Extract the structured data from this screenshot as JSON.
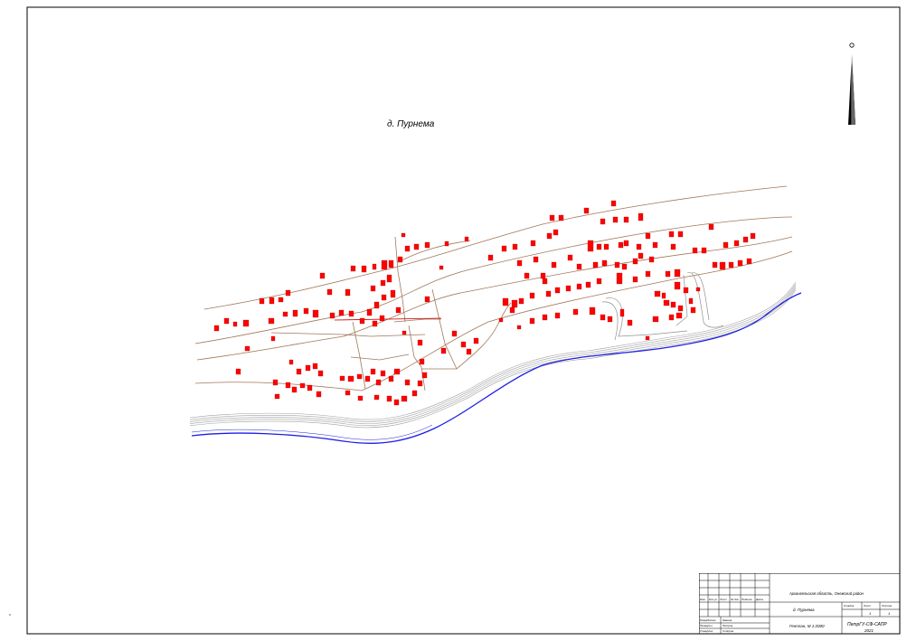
{
  "map": {
    "settlement_label": "д. Пурнема",
    "building_color": "#ff0000",
    "contour_color": "#a0785a",
    "road_color": "#a0a0a0",
    "river_color": "#1e1ee6",
    "north_arrow": "north-arrow-icon"
  },
  "title_block": {
    "region": "Архангельская область, Онежский район",
    "object": "д. Пурнема",
    "sheet_name": "Генплан, М 1:2000",
    "stage_label": "Стадия",
    "sheet_label": "Лист",
    "sheets_label": "Листов",
    "stage": "",
    "sheet": "1",
    "sheets": "1",
    "org": "ПетрГУ-СФ-САПР",
    "year": "2021",
    "header_cols": [
      "Изм.",
      "Кол.уч",
      "Лист",
      "№ док",
      "Подпись",
      "Дата"
    ],
    "roles": [
      {
        "role": "Разработал",
        "name": "Иванов"
      },
      {
        "role": "Проверил",
        "name": "Петров"
      },
      {
        "role": "Утвердил",
        "name": "Сидоров"
      }
    ]
  }
}
